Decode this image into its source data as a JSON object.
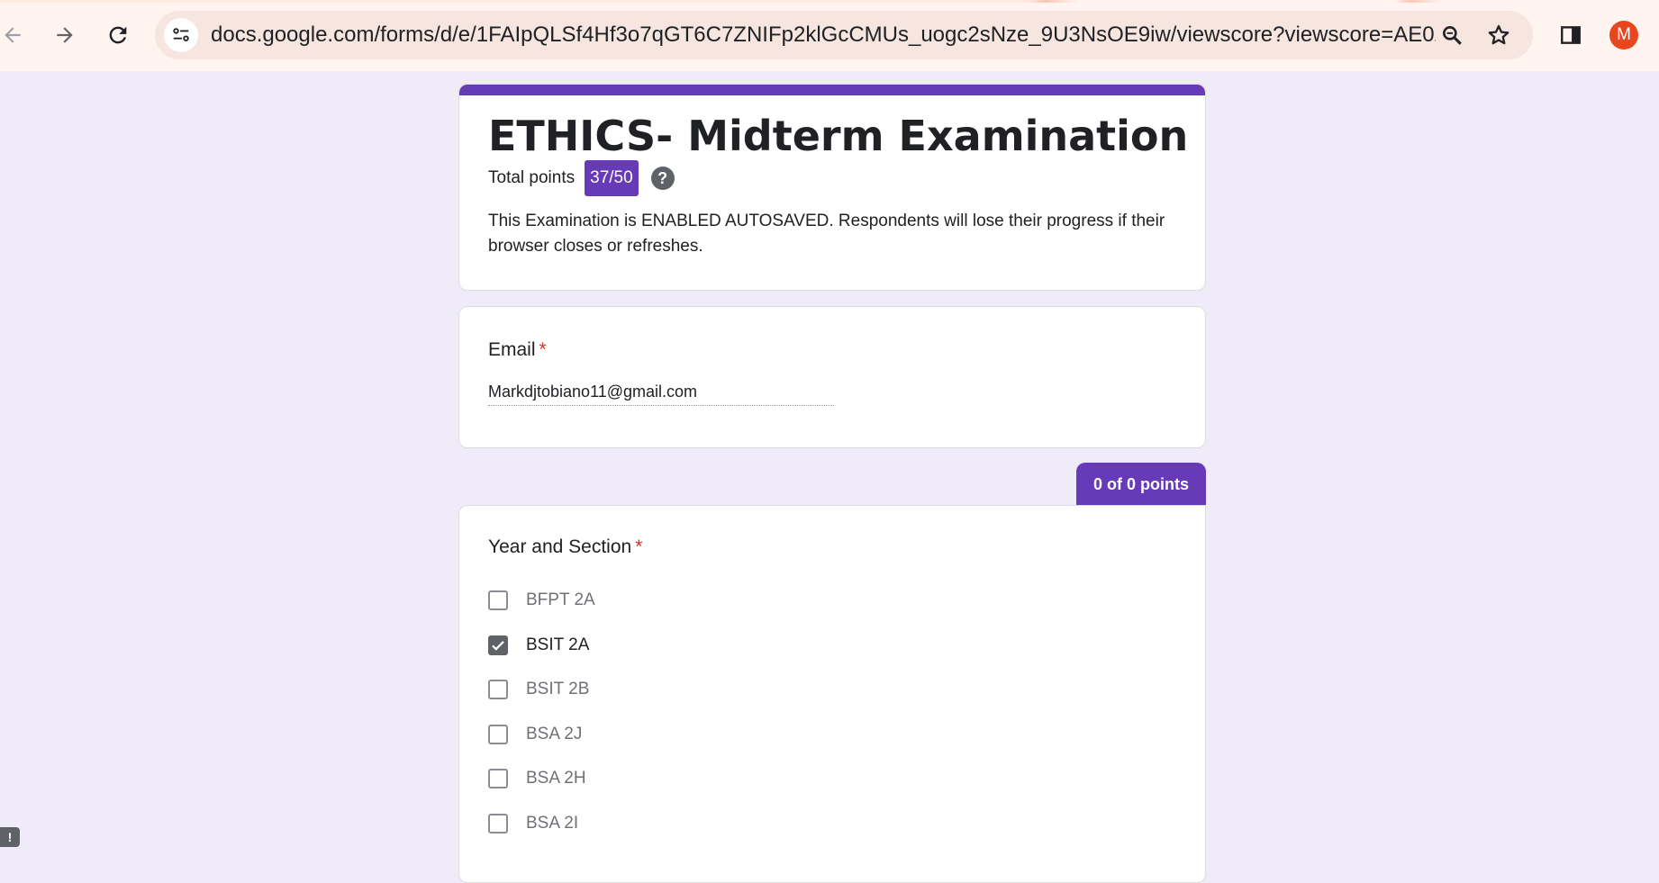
{
  "browser": {
    "url": "docs.google.com/forms/d/e/1FAIpQLSf4Hf3o7qGT6C7ZNIFp2klGcCMUs_uogc2sNze_9U3NsOE9iw/viewscore?viewscore=AE0zAgD_R...",
    "profile_initial": "M",
    "icons": [
      "back-icon",
      "forward-icon",
      "reload-icon",
      "site-info-icon",
      "zoom-icon",
      "bookmark-star-icon",
      "side-panel-icon"
    ]
  },
  "form": {
    "title": "ETHICS- Midterm Examination",
    "total_points_label": "Total points",
    "score": "37/50",
    "help_glyph": "?",
    "description": "This Examination is ENABLED AUTOSAVED. Respondents will lose their progress if their browser closes or refreshes.",
    "accent_color": "#673ab7"
  },
  "email_question": {
    "label": "Email",
    "required_mark": "*",
    "value": "Markdjtobiano11@gmail.com"
  },
  "section_question": {
    "points": "0 of 0 points",
    "label": "Year and Section",
    "required_mark": "*",
    "options": [
      {
        "label": "BFPT 2A",
        "checked": false
      },
      {
        "label": "BSIT 2A",
        "checked": true
      },
      {
        "label": "BSIT 2B",
        "checked": false
      },
      {
        "label": "BSA 2J",
        "checked": false
      },
      {
        "label": "BSA 2H",
        "checked": false
      },
      {
        "label": "BSA 2I",
        "checked": false
      }
    ]
  },
  "report_glyph": "!"
}
